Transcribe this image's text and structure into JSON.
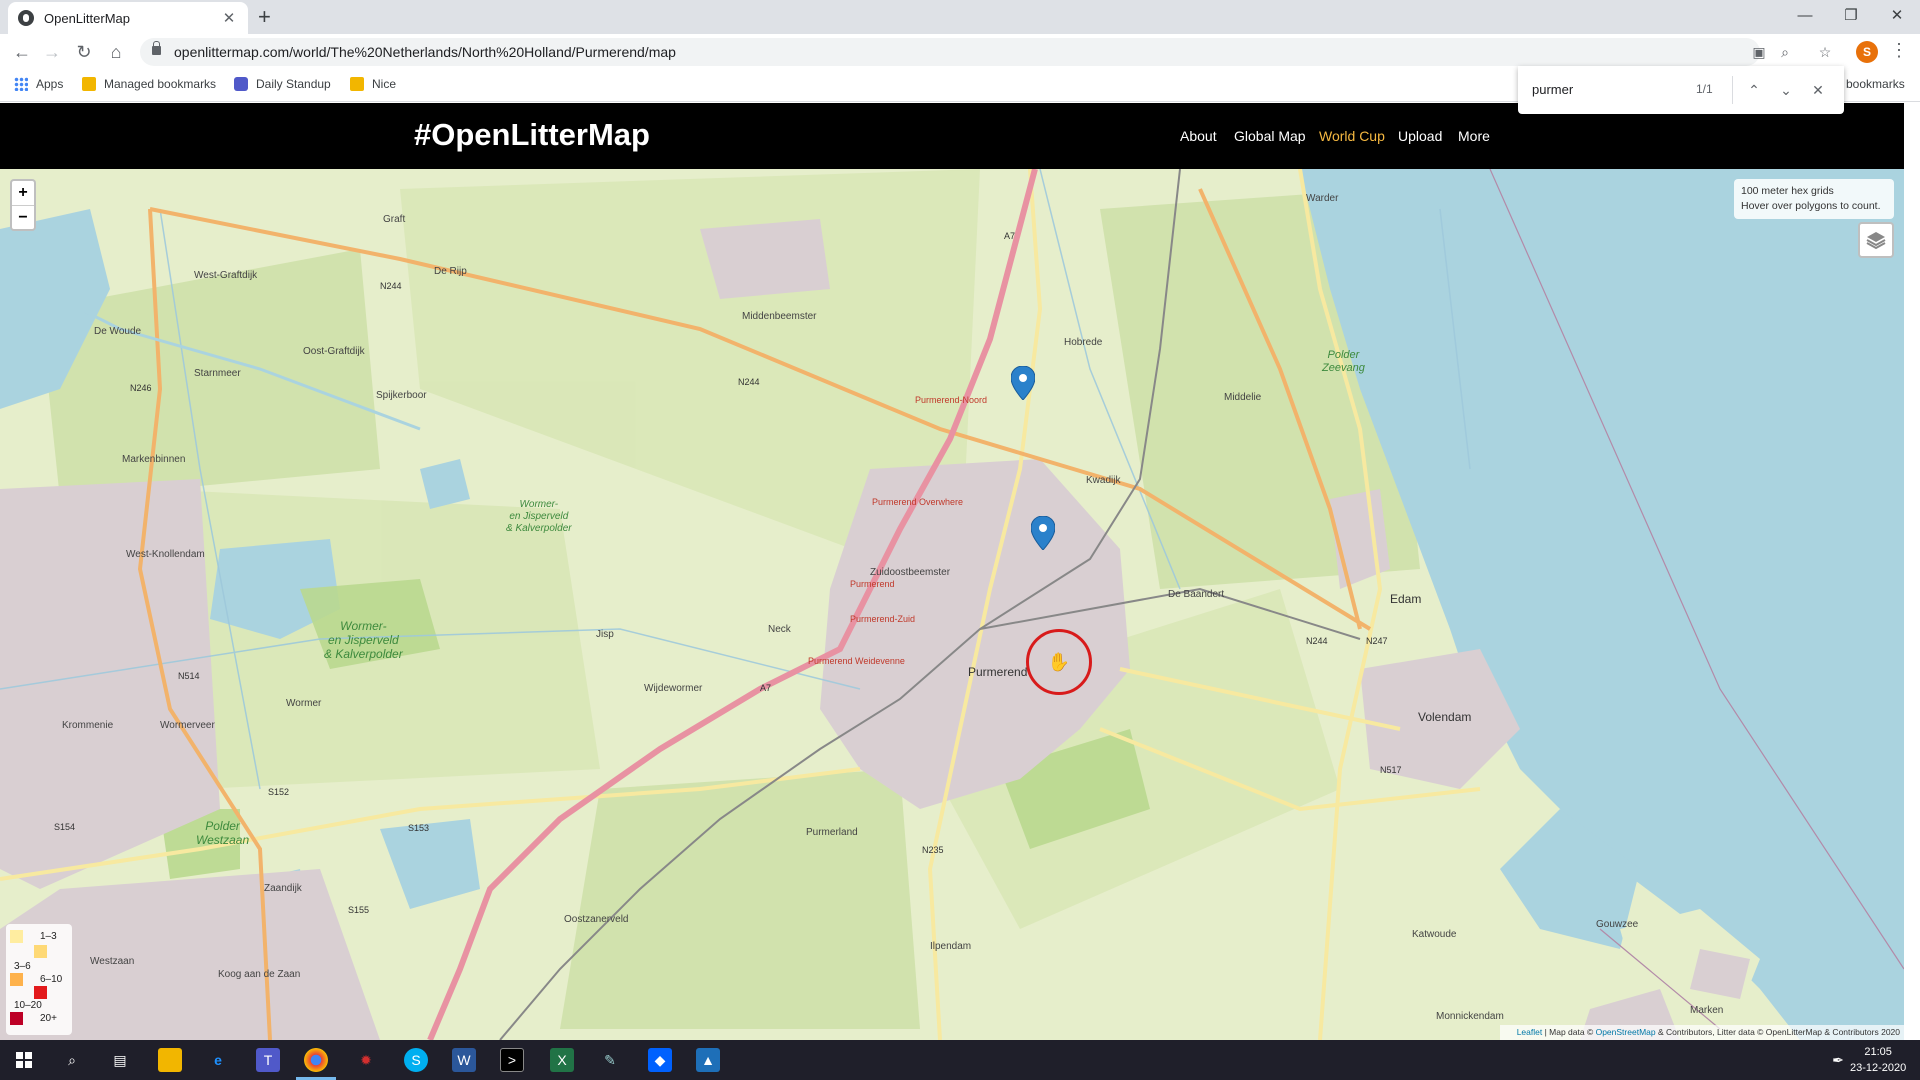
{
  "browser": {
    "tab_title": "OpenLitterMap",
    "tab_close": "✕",
    "new_tab": "+",
    "url": "openlittermap.com/world/The%20Netherlands/North%20Holland/Purmerend/map",
    "profile_initial": "S",
    "bookmarks": [
      "Apps",
      "Managed bookmarks",
      "Daily Standup",
      "Nice"
    ],
    "bookmarks_overflow": "bookmarks",
    "find": {
      "query": "purmer",
      "count": "1/1"
    }
  },
  "site": {
    "brand": "#OpenLitterMap",
    "nav": [
      "About",
      "Global Map",
      "World Cup",
      "Upload",
      "More"
    ],
    "active_nav": "World Cup"
  },
  "map": {
    "zoom_in": "+",
    "zoom_out": "−",
    "info_line1": "100 meter hex grids",
    "info_line2": "Hover over polygons to count.",
    "legend": [
      {
        "label": "1–3",
        "color": "#ffeda0"
      },
      {
        "label": "3–6",
        "color": "#fed976"
      },
      {
        "label": "6–10",
        "color": "#feb24c"
      },
      {
        "label": "10–20",
        "color": "#e31a1c"
      },
      {
        "label": "20+",
        "color": "#bd0026"
      }
    ],
    "attribution": {
      "leaflet": "Leaflet",
      "map_data": " | Map data © ",
      "osm": "OpenStreetMap",
      "rest": " & Contributors, Litter data © OpenLitterMap & Contributors 2020"
    },
    "places": {
      "purmerend": "Purmerend",
      "edam": "Edam",
      "volendam": "Volendam",
      "middenbeemster": "Middenbeemster",
      "zuidoostbeemster": "Zuidoostbeemster",
      "de_rijp": "De Rijp",
      "graft": "Graft",
      "west_graftdijk": "West-Graftdijk",
      "oost_graftdijk": "Oost-Graftdijk",
      "de_woude": "De Woude",
      "starnmeer": "Starnmeer",
      "spijkerboor": "Spijkerboor",
      "markenbinnen": "Markenbinnen",
      "west_knollendam": "West-Knollendam",
      "wormer": "Wormer",
      "wormerveer": "Wormerveer",
      "krommenie": "Krommenie",
      "westzaan": "Westzaan",
      "koog": "Koog aan de Zaan",
      "zaandijk": "Zaandijk",
      "neck": "Neck",
      "wijdewormer": "Wijdewormer",
      "jisp": "Jisp",
      "purmerland": "Purmerland",
      "ilpendam": "Ilpendam",
      "oostzanerveld": "Oostzanerveld",
      "kwadijk": "Kwadijk",
      "hobrede": "Hobrede",
      "middelie": "Middelie",
      "warder": "Warder",
      "katwoude": "Katwoude",
      "monnickendam": "Monnickendam",
      "marken": "Marken",
      "gouwzee": "Gouwzee",
      "de_baandert": "De Baandert",
      "polder_zeevang_1": "Polder",
      "polder_zeevang_2": "Zeevang",
      "wormer_jisp_1": "Wormer-",
      "wormer_jisp_2": "en Jisperveld",
      "wormer_jisp_3": "& Kalverpolder",
      "wormer_jisp_big_1": "Wormer-",
      "wormer_jisp_big_2": "en Jisperveld",
      "wormer_jisp_big_3": "& Kalverpolder",
      "polder_westzaan_1": "Polder",
      "polder_westzaan_2": "Westzaan",
      "station_noord": "Purmerend-Noord",
      "station_overwhere": "Purmerend Overwhere",
      "station_zuid": "Purmerend-Zuid",
      "station_weidevenne": "Purmerend Weidevenne",
      "station_purmerend": "Purmerend",
      "road_a7": "A7",
      "road_a7b": "A7",
      "road_n244": "N244",
      "road_n244b": "N244",
      "road_n244c": "N244",
      "road_n246": "N246",
      "road_n247": "N247",
      "road_n514": "N514",
      "road_n517": "N517",
      "road_n235": "N235",
      "road_s152": "S152",
      "road_s153": "S153",
      "road_s154": "S154",
      "road_s155": "S155"
    }
  },
  "taskbar": {
    "time": "21:05",
    "date": "23-12-2020"
  },
  "colors": {
    "nav_active": "#f5b841",
    "header_bg": "#000000",
    "water": "#aad3df",
    "land": "#e6eecb",
    "rail_road": "#e892a2",
    "cursor_ring": "#d81b1b",
    "marker": "#2a81cb"
  }
}
